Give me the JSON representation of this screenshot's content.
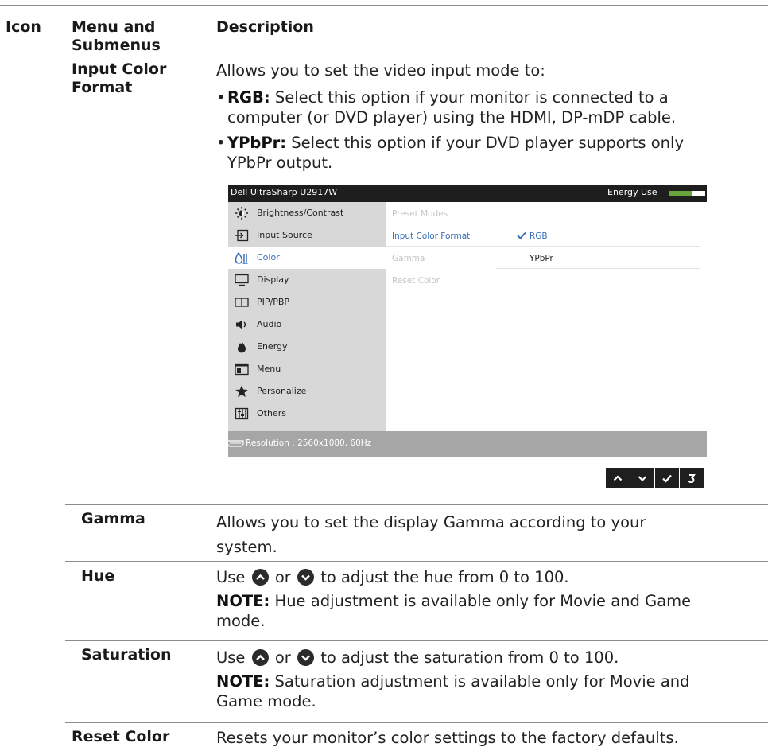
{
  "header": {
    "icon": "Icon",
    "menu_line1": "Menu and",
    "menu_line2": "Submenus",
    "description": "Description"
  },
  "input_color_format": {
    "menu_line1": "Input Color",
    "menu_line2": "Format",
    "intro": "Allows you to set the video input mode to:",
    "rgb_label": "RGB:",
    "rgb_line1": " Select this option if your monitor is connected to a",
    "rgb_line2": "computer (or DVD player) using the HDMI, DP-mDP cable.",
    "ypbpr_label": "YPbPr:",
    "ypbpr_line1": " Select this option if your DVD player supports only",
    "ypbpr_line2": "YPbPr output."
  },
  "osd": {
    "title": "Dell UltraSharp U2917W",
    "energy_label": "Energy Use",
    "energy_level": 0.65,
    "menu_items": [
      {
        "label": "Brightness/Contrast",
        "icon": "brightness-icon"
      },
      {
        "label": "Input Source",
        "icon": "input-source-icon"
      },
      {
        "label": "Color",
        "icon": "color-icon"
      },
      {
        "label": "Display",
        "icon": "display-icon"
      },
      {
        "label": "PIP/PBP",
        "icon": "pip-pbp-icon"
      },
      {
        "label": "Audio",
        "icon": "audio-icon"
      },
      {
        "label": "Energy",
        "icon": "energy-icon"
      },
      {
        "label": "Menu",
        "icon": "menu-icon"
      },
      {
        "label": "Personalize",
        "icon": "star-icon"
      },
      {
        "label": "Others",
        "icon": "others-icon"
      }
    ],
    "selected_item": "Color",
    "submenu": [
      "Preset Modes",
      "Input Color Format",
      "Gamma",
      "Reset Color"
    ],
    "active_submenu": "Input Color Format",
    "options": [
      "RGB",
      "YPbPr"
    ],
    "checked_option": "RGB",
    "status": "Resolution : 2560x1080, 60Hz"
  },
  "nav_buttons": [
    "up-icon",
    "down-icon",
    "check-icon",
    "back-icon"
  ],
  "gamma": {
    "menu": "Gamma",
    "line1": "Allows you to set the display Gamma according to your",
    "line2": "system."
  },
  "hue": {
    "menu": "Hue",
    "use": "Use",
    "or": "or",
    "rest": "to adjust the hue from 0 to 100.",
    "note_label": "NOTE:",
    "note_line1": " Hue adjustment is available only for Movie and Game",
    "note_line2": "mode."
  },
  "saturation": {
    "menu": "Saturation",
    "use": "Use",
    "or": "or",
    "rest": "to adjust the saturation from 0 to 100.",
    "note_label": "NOTE:",
    "note_line1": " Saturation adjustment is available only for Movie and",
    "note_line2": "Game mode."
  },
  "reset_color": {
    "menu": "Reset Color",
    "line1": "Resets your monitor’s color settings to the factory defaults."
  }
}
